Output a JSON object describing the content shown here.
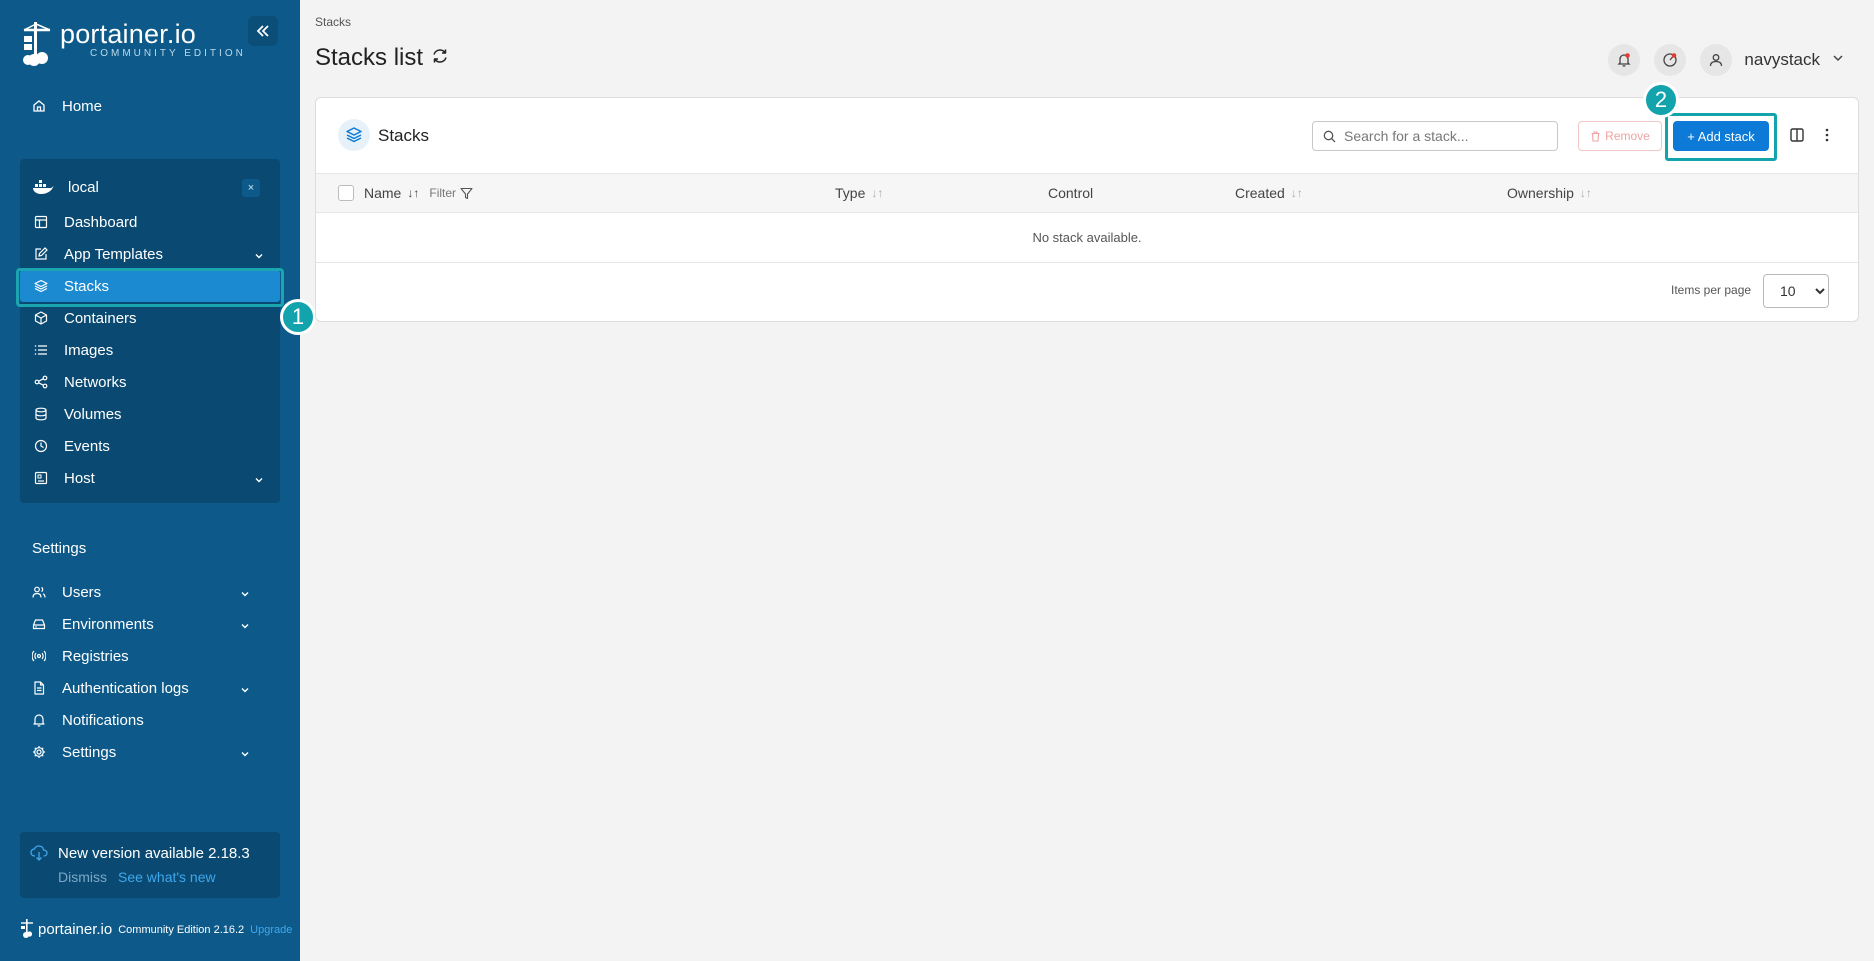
{
  "brand": {
    "name": "portainer.io",
    "edition": "COMMUNITY EDITION"
  },
  "sidebar": {
    "home_label": "Home",
    "environment": {
      "name": "local",
      "close_label": "×",
      "items": [
        {
          "label": "Dashboard"
        },
        {
          "label": "App Templates"
        },
        {
          "label": "Stacks"
        },
        {
          "label": "Containers"
        },
        {
          "label": "Images"
        },
        {
          "label": "Networks"
        },
        {
          "label": "Volumes"
        },
        {
          "label": "Events"
        },
        {
          "label": "Host"
        }
      ]
    },
    "settings_title": "Settings",
    "settings_items": [
      {
        "label": "Users"
      },
      {
        "label": "Environments"
      },
      {
        "label": "Registries"
      },
      {
        "label": "Authentication logs"
      },
      {
        "label": "Notifications"
      },
      {
        "label": "Settings"
      }
    ],
    "update": {
      "title": "New version available 2.18.3",
      "dismiss": "Dismiss",
      "see_new": "See what's new"
    },
    "footer": {
      "name": "portainer.io",
      "edition": "Community Edition 2.16.2",
      "upgrade": "Upgrade"
    }
  },
  "annotations": {
    "badge1": "1",
    "badge2": "2"
  },
  "header": {
    "breadcrumb": "Stacks",
    "title": "Stacks list",
    "user": "navystack"
  },
  "card": {
    "title": "Stacks",
    "search_placeholder": "Search for a stack...",
    "remove_label": "Remove",
    "add_label": "+ Add stack",
    "columns": {
      "name": "Name",
      "filter": "Filter",
      "type": "Type",
      "control": "Control",
      "created": "Created",
      "ownership": "Ownership"
    },
    "empty_text": "No stack available.",
    "items_per_page_label": "Items per page",
    "items_per_page_value": "10"
  },
  "colors": {
    "sidebar_bg": "#0d5a8a",
    "active_item": "#1b8ad0",
    "accent": "#0c7ad6",
    "highlight": "#13a3ac"
  }
}
